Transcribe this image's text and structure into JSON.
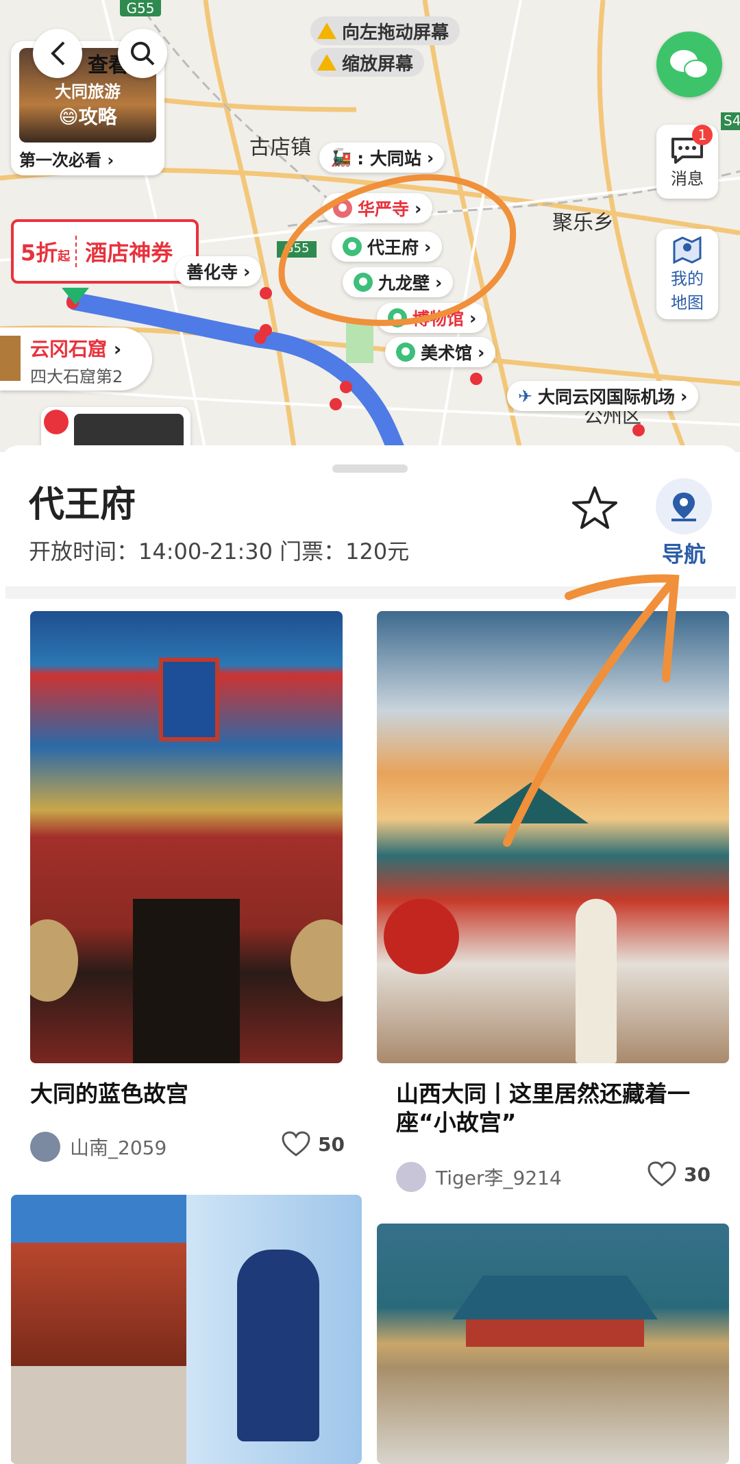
{
  "map": {
    "hint1": "向左拖动屏幕",
    "hint2": "缩放屏幕",
    "guide_card": {
      "img_text1": "查看",
      "img_text2": "大同旅游",
      "img_text3": "😄攻略",
      "caption": "第一次必看"
    },
    "hotel_coupon": {
      "discount": "5折",
      "discount_suffix": "起",
      "label": "酒店神券"
    },
    "place_labels": {
      "gudianzhen": "古店镇",
      "julexiang": "聚乐乡",
      "gongzhou": "公州区"
    },
    "road_labels": {
      "g55": "G55",
      "s4": "S4",
      "g55b": "G55"
    },
    "pois": {
      "datong_station": "大同站",
      "huayan_temple": "华严寺",
      "daiwangfu": "代王府",
      "jiulongbi": "九龙壁",
      "shanhua_temple": "善化寺",
      "museum": "博物馆",
      "art_museum": "美术馆",
      "airport": "大同云冈国际机场",
      "yungang": "云冈石窟",
      "yungang_sub": "四大石窟第2"
    },
    "message": {
      "label": "消息",
      "badge": "1"
    },
    "my_map": {
      "label1": "我的",
      "label2": "地图"
    }
  },
  "poi": {
    "title": "代王府",
    "info": "开放时间：14:00-21:30 门票：120元",
    "nav_label": "导航"
  },
  "posts": [
    {
      "title": "大同的蓝色故宫",
      "author": "山南_2059",
      "likes": "50"
    },
    {
      "title": "山西大同丨这里居然还藏着一座“小故宫”",
      "author": "Tiger李_9214",
      "likes": "30"
    }
  ],
  "colors": {
    "accent": "#2b5ca8",
    "annotation": "#f0903a",
    "coupon": "#e8323c",
    "wechat": "#3dc46a"
  }
}
